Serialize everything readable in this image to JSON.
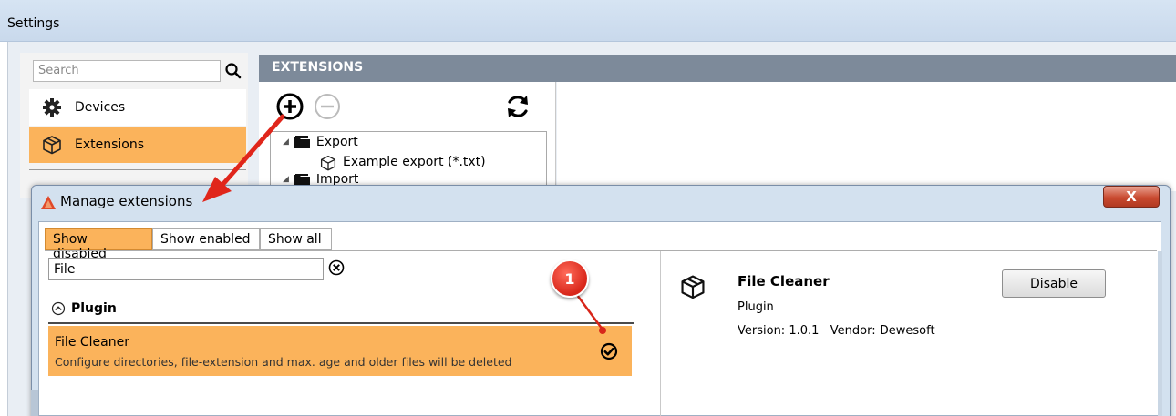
{
  "settings": {
    "title": "Settings",
    "search_placeholder": "Search",
    "nav": [
      {
        "label": "Devices",
        "icon": "gear-icon"
      },
      {
        "label": "Extensions",
        "icon": "package-icon"
      }
    ],
    "section_header": "EXTENSIONS",
    "tree": [
      {
        "label": "Export",
        "icon": "folder-icon"
      },
      {
        "label": "Example export (*.txt)",
        "icon": "package-icon"
      },
      {
        "label": "Import",
        "icon": "folder-icon"
      }
    ]
  },
  "dialog": {
    "title": "Manage extensions",
    "close_label": "X",
    "tabs": [
      {
        "label": "Show disabled",
        "selected": true
      },
      {
        "label": "Show enabled",
        "selected": false
      },
      {
        "label": "Show all",
        "selected": false
      }
    ],
    "filter_value": "File",
    "group_label": "Plugin",
    "plugins": [
      {
        "name": "File Cleaner",
        "description": "Configure directories, file-extension and max. age and older files will be deleted",
        "checked": true
      }
    ],
    "detail": {
      "name": "File Cleaner",
      "type": "Plugin",
      "version_line": "Version: 1.0.1   Vendor: Dewesoft",
      "action_label": "Disable"
    }
  },
  "annotation": {
    "badge_number": "1"
  },
  "colors": {
    "selection_orange": "#fbb35b",
    "header_slate": "#7d8a9a",
    "annotation_red": "#d8261a"
  }
}
